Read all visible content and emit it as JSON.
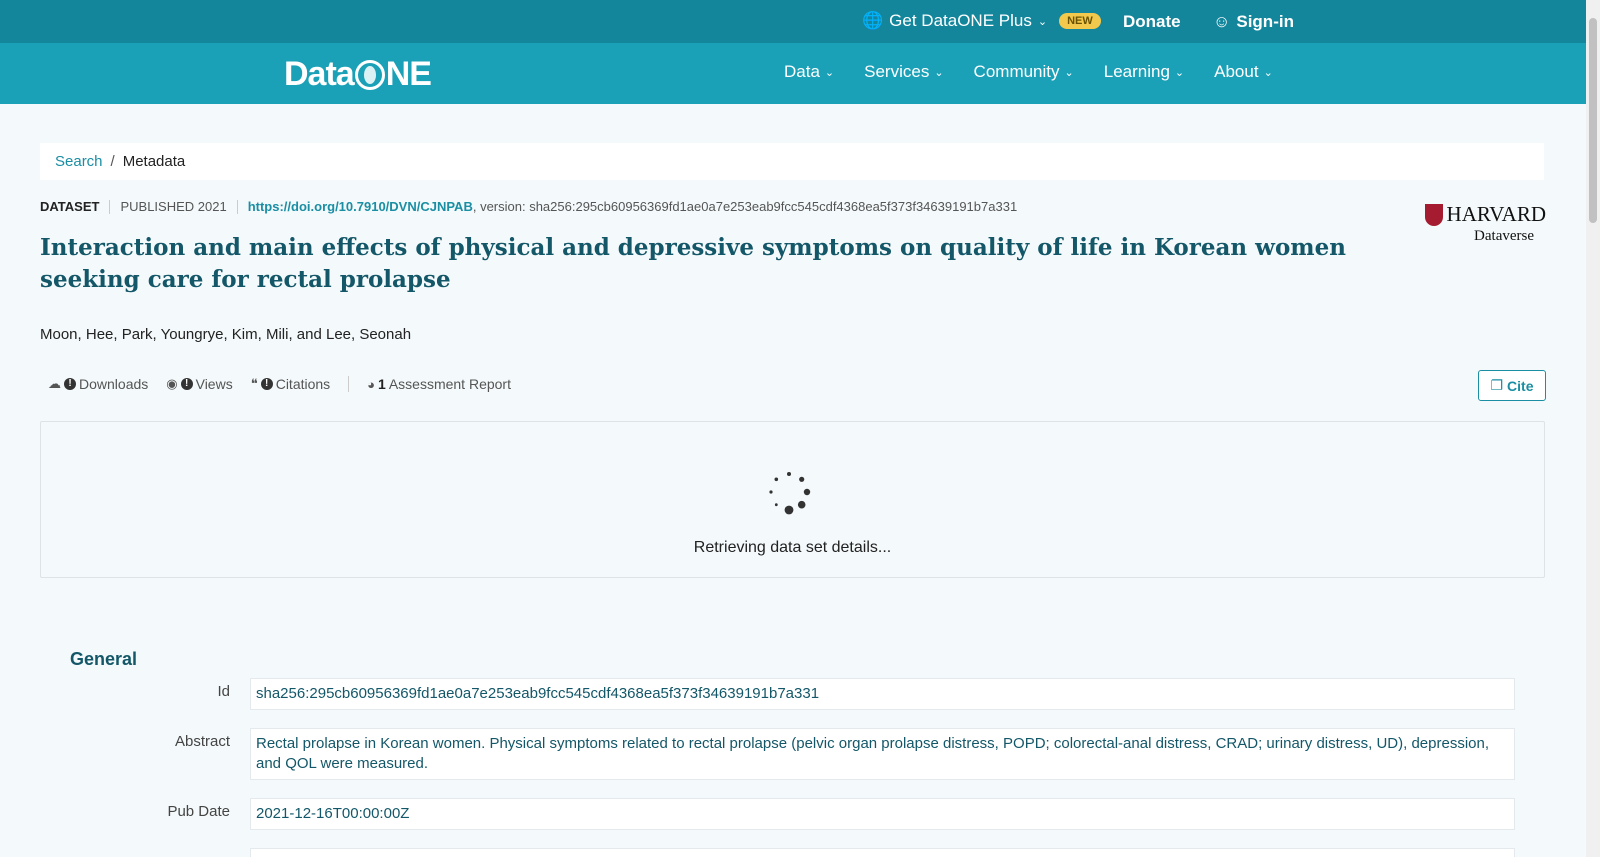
{
  "topbar": {
    "plus_label": "Get DataONE Plus",
    "new_badge": "NEW",
    "donate": "Donate",
    "signin": "Sign-in"
  },
  "navbar": {
    "logo_left": "Data",
    "logo_right": "NE",
    "items": [
      "Data",
      "Services",
      "Community",
      "Learning",
      "About"
    ]
  },
  "breadcrumb": {
    "search": "Search",
    "sep": "/",
    "current": "Metadata"
  },
  "dataset": {
    "type": "DATASET",
    "published": "PUBLISHED 2021",
    "doi": "https://doi.org/10.7910/DVN/CJNPAB",
    "version": ", version: sha256:295cb60956369fd1ae0a7e253eab9fcc545cdf4368ea5f373f34639191b7a331",
    "repository_line1": "HARVARD",
    "repository_line2": "Dataverse",
    "title": "Interaction and main effects of physical and depressive symptoms on quality of life in Korean women seeking care for rectal prolapse",
    "authors": "Moon, Hee, Park, Youngrye, Kim, Mili, and Lee, Seonah"
  },
  "metrics": {
    "downloads": "Downloads",
    "views": "Views",
    "citations": "Citations",
    "assessment_count": "1",
    "assessment": "Assessment Report",
    "cite": "Cite"
  },
  "loading": {
    "text": "Retrieving data set details..."
  },
  "general": {
    "heading": "General",
    "id_label": "Id",
    "id_value": "sha256:295cb60956369fd1ae0a7e253eab9fcc545cdf4368ea5f373f34639191b7a331",
    "abstract_label": "Abstract",
    "abstract_value": "Rectal prolapse in Korean women. Physical symptoms related to rectal prolapse (pelvic organ prolapse distress, POPD; colorectal-anal distress, CRAD; urinary distress, UD), depression, and QOL were measured.",
    "pubdate_label": "Pub Date",
    "pubdate_value": "2021-12-16T00:00:00Z"
  },
  "colors": {
    "topbar": "#14869c",
    "navbar": "#1aa1b7",
    "accent": "#1a8ea3",
    "title": "#135768"
  }
}
